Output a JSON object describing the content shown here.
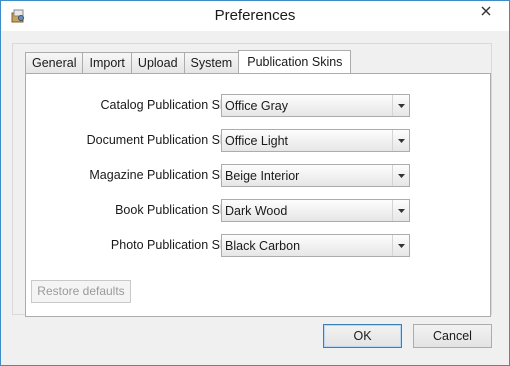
{
  "window": {
    "title": "Preferences"
  },
  "tabs": [
    {
      "label": "General"
    },
    {
      "label": "Import"
    },
    {
      "label": "Upload"
    },
    {
      "label": "System"
    },
    {
      "label": "Publication Skins",
      "active": true
    }
  ],
  "skins": [
    {
      "label": "Catalog Publication Skin",
      "value": "Office Gray"
    },
    {
      "label": "Document Publication Skin",
      "value": "Office Light"
    },
    {
      "label": "Magazine Publication Skin",
      "value": "Beige Interior"
    },
    {
      "label": "Book Publication Skin",
      "value": "Dark Wood"
    },
    {
      "label": "Photo Publication Skin",
      "value": "Black Carbon"
    }
  ],
  "restore_label": "Restore defaults",
  "ok_label": "OK",
  "cancel_label": "Cancel",
  "icons": {
    "app": "preferences-app-icon",
    "close": "close-icon",
    "dropdown": "chevron-down-icon"
  },
  "colors": {
    "window_border": "#3c8dc8",
    "default_button_border": "#3c7fb1"
  }
}
